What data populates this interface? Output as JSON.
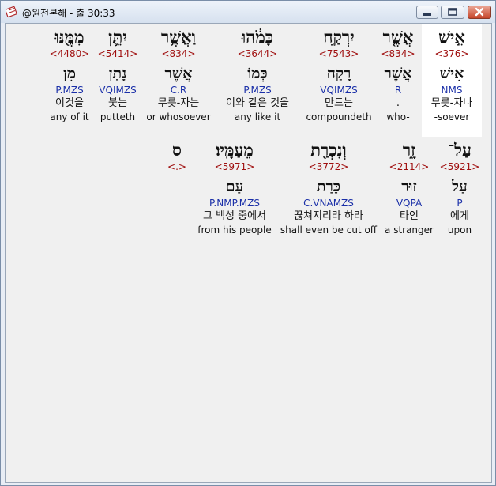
{
  "window": {
    "title": "@원전본해 - 출 30:33",
    "minimize_label": "minimize",
    "maximize_label": "maximize",
    "close_label": "close"
  },
  "colors": {
    "hebrew": "#111111",
    "strongs": "#a01010",
    "morph": "#1a2fa8",
    "selected_bg": "#ffffff"
  },
  "rows": [
    {
      "words": [
        {
          "heb": "אִ֣ישׁ",
          "num": "<376>",
          "lemma": "אִישׁ",
          "morph": "NMS",
          "ko": "무릇-자나",
          "en": "-soever",
          "selected": true
        },
        {
          "heb": "אֲשֶׁ֤ר",
          "num": "<834>",
          "lemma": "אֲשֶׁר",
          "morph": "R",
          "ko": ".",
          "en": "who-"
        },
        {
          "heb": "יִרְקַ֣ח",
          "num": "<7543>",
          "lemma": "רָקַח",
          "morph": "VQIMZS",
          "ko": "만드는",
          "en": "compoundeth"
        },
        {
          "heb": "כָּמֹ֔הוּ",
          "num": "<3644>",
          "lemma": "כְּמוֹ",
          "morph": "P.MZS",
          "ko": "이와 같은 것을",
          "en": "any like it"
        },
        {
          "heb": "וַאֲשֶׁ֥ר",
          "num": "<834>",
          "lemma": "אֲשֶׁר",
          "morph": "C.R",
          "ko": "무릇-자는",
          "en": "or whosoever"
        },
        {
          "heb": "יִתֵּ֛ן",
          "num": "<5414>",
          "lemma": "נָתַן",
          "morph": "VQIMZS",
          "ko": "붓는",
          "en": "putteth"
        },
        {
          "heb": "מִמֶּ֖נּוּ",
          "num": "<4480>",
          "lemma": "מִן",
          "morph": "P.MZS",
          "ko": "이것을",
          "en": "any of it"
        }
      ]
    },
    {
      "words": [
        {
          "heb": "עַל־",
          "num": "<5921>",
          "lemma": "עַל",
          "morph": "P",
          "ko": "에게",
          "en": "upon"
        },
        {
          "heb": "זָ֑ר",
          "num": "<2114>",
          "lemma": "זוּר",
          "morph": "VQPA",
          "ko": "타인",
          "en": "a stranger"
        },
        {
          "heb": "וְנִכְרַ֖ת",
          "num": "<3772>",
          "lemma": "כָּרַת",
          "morph": "C.VNAMZS",
          "ko": "끊쳐지리라 하라",
          "en": "shall even be cut off"
        },
        {
          "heb": "מֵעַמָּֽיו׃",
          "num": "<5971>",
          "lemma": "עַם",
          "morph": "P.NMP.MZS",
          "ko": "그 백성 중에서",
          "en": "from his people"
        },
        {
          "heb": "ס",
          "num": "<.>",
          "lemma": "",
          "morph": "",
          "ko": "",
          "en": ""
        }
      ]
    }
  ]
}
